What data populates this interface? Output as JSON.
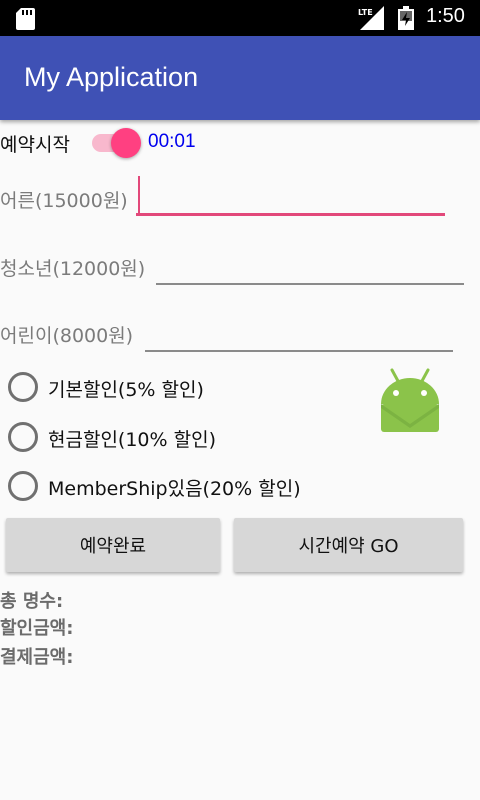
{
  "status_bar": {
    "network_label": "LTE",
    "time": "1:50",
    "icons": [
      "sd-card-icon",
      "lte-signal-icon",
      "battery-icon"
    ]
  },
  "app_bar": {
    "title": "My Application",
    "color": "#3f51b5"
  },
  "reservation": {
    "switch_label": "예약시작",
    "switch_on": true,
    "chronometer": "00:01",
    "accent_color": "#ff4081"
  },
  "fields": {
    "adult_label": "어른(15000원)",
    "adult_value": "",
    "youth_label": "청소년(12000원)",
    "youth_value": "",
    "child_label": "어린이(8000원)",
    "child_value": ""
  },
  "discounts": {
    "options": [
      "기본할인(5% 할인)",
      "현금할인(10% 할인)",
      "MemberShip있음(20% 할인)"
    ],
    "selected": null
  },
  "image": {
    "icon": "android-icon",
    "color": "#8bc34a"
  },
  "buttons": {
    "complete_label": "예약완료",
    "time_go_label": "시간예약 GO"
  },
  "summary": {
    "total_count_label": "총 명수:",
    "discount_amount_label": "할인금액:",
    "payment_amount_label": "결제금액:"
  }
}
